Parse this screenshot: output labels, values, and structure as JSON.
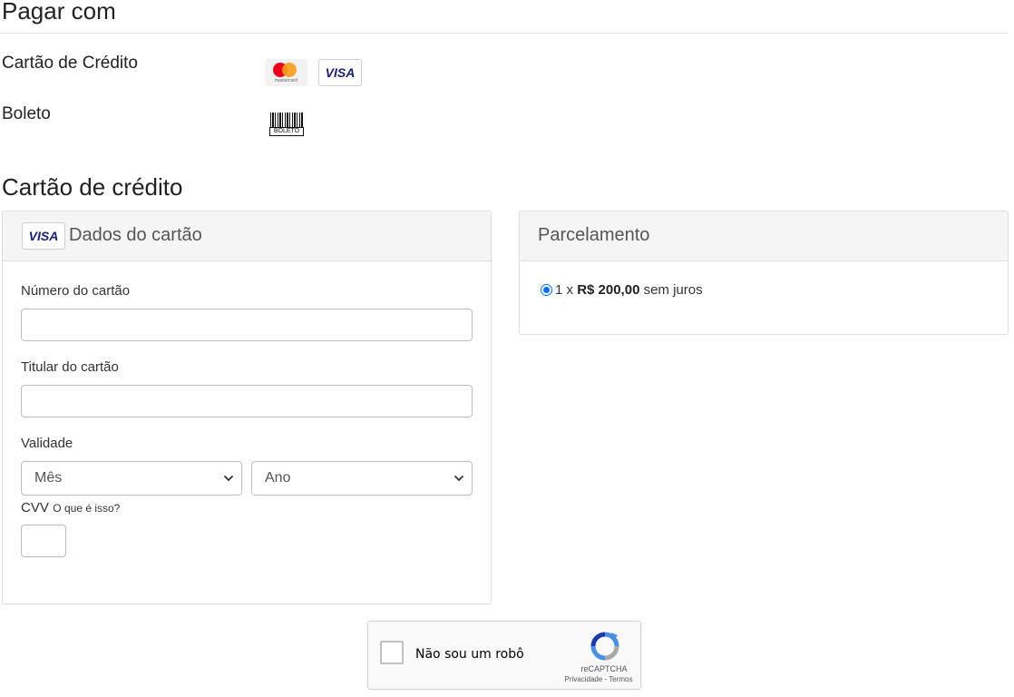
{
  "pay_with": {
    "title": "Pagar com",
    "methods": [
      {
        "label": "Cartão de Crédito",
        "badges": [
          "mastercard",
          "VISA"
        ],
        "mastercard_caption": "mastercard"
      },
      {
        "label": "Boleto",
        "badge_text": "BOLETO"
      }
    ]
  },
  "credit_card": {
    "title": "Cartão de crédito",
    "card_panel": {
      "badge": "VISA",
      "title": "Dados do cartão",
      "number_label": "Número do cartão",
      "number_value": "",
      "holder_label": "Titular do cartão",
      "holder_value": "",
      "expiry_label": "Validade",
      "month_selected": "Mês",
      "year_selected": "Ano",
      "cvv_label": "CVV",
      "cvv_help": "O que é isso?",
      "cvv_value": ""
    },
    "installments_panel": {
      "title": "Parcelamento",
      "option": {
        "count": "1 x",
        "amount": "R$ 200,00",
        "suffix": "sem juros",
        "selected": true
      }
    }
  },
  "recaptcha": {
    "label": "Não sou um robô",
    "brand": "reCAPTCHA",
    "links": "Privacidade - Termos"
  },
  "colors": {
    "mastercard_red": "#eb001b",
    "mastercard_orange": "#f79e1b",
    "visa_blue": "#1a1f71",
    "radio_blue": "#0d6efd",
    "recaptcha_blue": "#4a90e2",
    "recaptcha_gray": "#aaaaaa"
  }
}
